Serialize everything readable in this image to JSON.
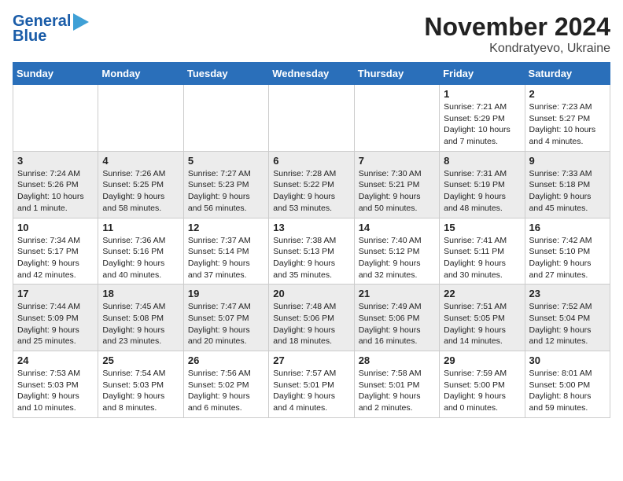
{
  "logo": {
    "line1": "General",
    "line2": "Blue"
  },
  "title": "November 2024",
  "subtitle": "Kondratyevo, Ukraine",
  "weekdays": [
    "Sunday",
    "Monday",
    "Tuesday",
    "Wednesday",
    "Thursday",
    "Friday",
    "Saturday"
  ],
  "rows": [
    [
      {
        "day": "",
        "info": ""
      },
      {
        "day": "",
        "info": ""
      },
      {
        "day": "",
        "info": ""
      },
      {
        "day": "",
        "info": ""
      },
      {
        "day": "",
        "info": ""
      },
      {
        "day": "1",
        "info": "Sunrise: 7:21 AM\nSunset: 5:29 PM\nDaylight: 10 hours and 7 minutes."
      },
      {
        "day": "2",
        "info": "Sunrise: 7:23 AM\nSunset: 5:27 PM\nDaylight: 10 hours and 4 minutes."
      }
    ],
    [
      {
        "day": "3",
        "info": "Sunrise: 7:24 AM\nSunset: 5:26 PM\nDaylight: 10 hours and 1 minute."
      },
      {
        "day": "4",
        "info": "Sunrise: 7:26 AM\nSunset: 5:25 PM\nDaylight: 9 hours and 58 minutes."
      },
      {
        "day": "5",
        "info": "Sunrise: 7:27 AM\nSunset: 5:23 PM\nDaylight: 9 hours and 56 minutes."
      },
      {
        "day": "6",
        "info": "Sunrise: 7:28 AM\nSunset: 5:22 PM\nDaylight: 9 hours and 53 minutes."
      },
      {
        "day": "7",
        "info": "Sunrise: 7:30 AM\nSunset: 5:21 PM\nDaylight: 9 hours and 50 minutes."
      },
      {
        "day": "8",
        "info": "Sunrise: 7:31 AM\nSunset: 5:19 PM\nDaylight: 9 hours and 48 minutes."
      },
      {
        "day": "9",
        "info": "Sunrise: 7:33 AM\nSunset: 5:18 PM\nDaylight: 9 hours and 45 minutes."
      }
    ],
    [
      {
        "day": "10",
        "info": "Sunrise: 7:34 AM\nSunset: 5:17 PM\nDaylight: 9 hours and 42 minutes."
      },
      {
        "day": "11",
        "info": "Sunrise: 7:36 AM\nSunset: 5:16 PM\nDaylight: 9 hours and 40 minutes."
      },
      {
        "day": "12",
        "info": "Sunrise: 7:37 AM\nSunset: 5:14 PM\nDaylight: 9 hours and 37 minutes."
      },
      {
        "day": "13",
        "info": "Sunrise: 7:38 AM\nSunset: 5:13 PM\nDaylight: 9 hours and 35 minutes."
      },
      {
        "day": "14",
        "info": "Sunrise: 7:40 AM\nSunset: 5:12 PM\nDaylight: 9 hours and 32 minutes."
      },
      {
        "day": "15",
        "info": "Sunrise: 7:41 AM\nSunset: 5:11 PM\nDaylight: 9 hours and 30 minutes."
      },
      {
        "day": "16",
        "info": "Sunrise: 7:42 AM\nSunset: 5:10 PM\nDaylight: 9 hours and 27 minutes."
      }
    ],
    [
      {
        "day": "17",
        "info": "Sunrise: 7:44 AM\nSunset: 5:09 PM\nDaylight: 9 hours and 25 minutes."
      },
      {
        "day": "18",
        "info": "Sunrise: 7:45 AM\nSunset: 5:08 PM\nDaylight: 9 hours and 23 minutes."
      },
      {
        "day": "19",
        "info": "Sunrise: 7:47 AM\nSunset: 5:07 PM\nDaylight: 9 hours and 20 minutes."
      },
      {
        "day": "20",
        "info": "Sunrise: 7:48 AM\nSunset: 5:06 PM\nDaylight: 9 hours and 18 minutes."
      },
      {
        "day": "21",
        "info": "Sunrise: 7:49 AM\nSunset: 5:06 PM\nDaylight: 9 hours and 16 minutes."
      },
      {
        "day": "22",
        "info": "Sunrise: 7:51 AM\nSunset: 5:05 PM\nDaylight: 9 hours and 14 minutes."
      },
      {
        "day": "23",
        "info": "Sunrise: 7:52 AM\nSunset: 5:04 PM\nDaylight: 9 hours and 12 minutes."
      }
    ],
    [
      {
        "day": "24",
        "info": "Sunrise: 7:53 AM\nSunset: 5:03 PM\nDaylight: 9 hours and 10 minutes."
      },
      {
        "day": "25",
        "info": "Sunrise: 7:54 AM\nSunset: 5:03 PM\nDaylight: 9 hours and 8 minutes."
      },
      {
        "day": "26",
        "info": "Sunrise: 7:56 AM\nSunset: 5:02 PM\nDaylight: 9 hours and 6 minutes."
      },
      {
        "day": "27",
        "info": "Sunrise: 7:57 AM\nSunset: 5:01 PM\nDaylight: 9 hours and 4 minutes."
      },
      {
        "day": "28",
        "info": "Sunrise: 7:58 AM\nSunset: 5:01 PM\nDaylight: 9 hours and 2 minutes."
      },
      {
        "day": "29",
        "info": "Sunrise: 7:59 AM\nSunset: 5:00 PM\nDaylight: 9 hours and 0 minutes."
      },
      {
        "day": "30",
        "info": "Sunrise: 8:01 AM\nSunset: 5:00 PM\nDaylight: 8 hours and 59 minutes."
      }
    ]
  ]
}
